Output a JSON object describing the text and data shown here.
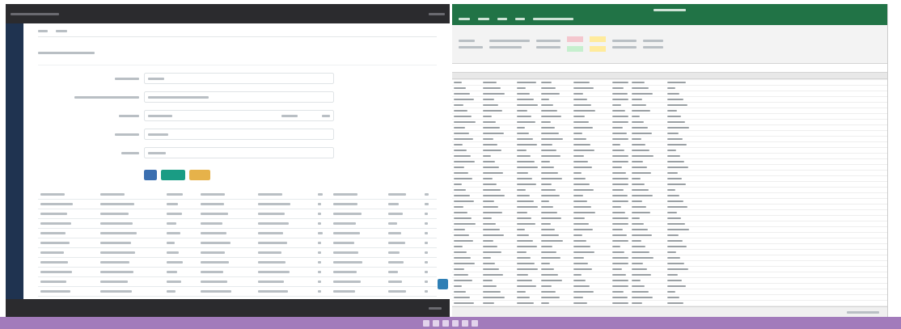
{
  "panels": [
    {
      "kind": "web_admin",
      "buttons": [
        {
          "color": "#3b6fb0"
        },
        {
          "color": "#1a9c84"
        },
        {
          "color": "#e6b24a"
        }
      ]
    },
    {
      "kind": "spreadsheet"
    }
  ]
}
